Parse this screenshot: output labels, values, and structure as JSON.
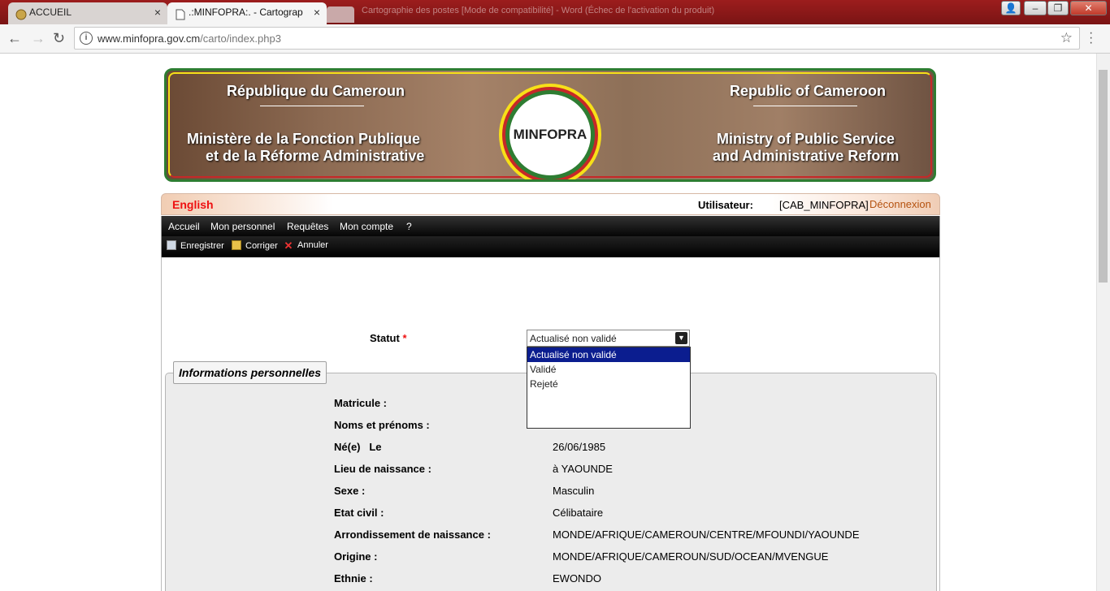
{
  "browser": {
    "tabs": [
      {
        "label": "ACCUEIL"
      },
      {
        "label": ".:MINFOPRA:. - Cartograp"
      }
    ],
    "background_title": "Cartographie des postes [Mode de compatibilité] - Word (Échec de l'activation du produit)",
    "url_domain": "www.minfopra.gov.cm",
    "url_path": "/carto/index.php3"
  },
  "banner": {
    "fr_country": "République du Cameroun",
    "fr_ministry_1": "Ministère de la Fonction Publique",
    "fr_ministry_2": "et de la Réforme Administrative",
    "en_country": "Republic of Cameroon",
    "en_ministry_1": "Ministry of Public Service",
    "en_ministry_2": "and Administrative Reform",
    "seal_text": "MINFOPRA"
  },
  "header": {
    "language_link": "English",
    "user_label": "Utilisateur:",
    "user_value": "[CAB_MINFOPRA]",
    "logout": "Déconnexion"
  },
  "menu": [
    "Accueil",
    "Mon personnel",
    "Requêtes",
    "Mon compte",
    "?"
  ],
  "toolbar": {
    "save": "Enregistrer",
    "edit": "Corriger",
    "cancel": "Annuler"
  },
  "form": {
    "statut_label": "Statut",
    "required_mark": "*",
    "statut_selected": "Actualisé non validé",
    "statut_options": [
      "Actualisé non validé",
      "Validé",
      "Rejeté"
    ]
  },
  "personal": {
    "legend": "Informations personnelles",
    "rows": [
      {
        "label": "Matricule :",
        "value": ""
      },
      {
        "label": "Noms et prénoms :",
        "value": ""
      },
      {
        "label": "Né(e)   Le",
        "value": "26/06/1985"
      },
      {
        "label": "Lieu de naissance :",
        "value": "à YAOUNDE"
      },
      {
        "label": "Sexe :",
        "value": "Masculin"
      },
      {
        "label": "Etat civil :",
        "value": "Célibataire"
      },
      {
        "label": "Arrondissement de naissance :",
        "value": "MONDE/AFRIQUE/CAMEROUN/CENTRE/MFOUNDI/YAOUNDE"
      },
      {
        "label": "Origine :",
        "value": "MONDE/AFRIQUE/CAMEROUN/SUD/OCEAN/MVENGUE"
      },
      {
        "label": "Ethnie :",
        "value": "EWONDO"
      }
    ]
  },
  "colors": {
    "accent_red": "#e11111",
    "menu_black": "#050505",
    "selection_blue": "#0b1d8f",
    "banner_green": "#2e7d32"
  }
}
